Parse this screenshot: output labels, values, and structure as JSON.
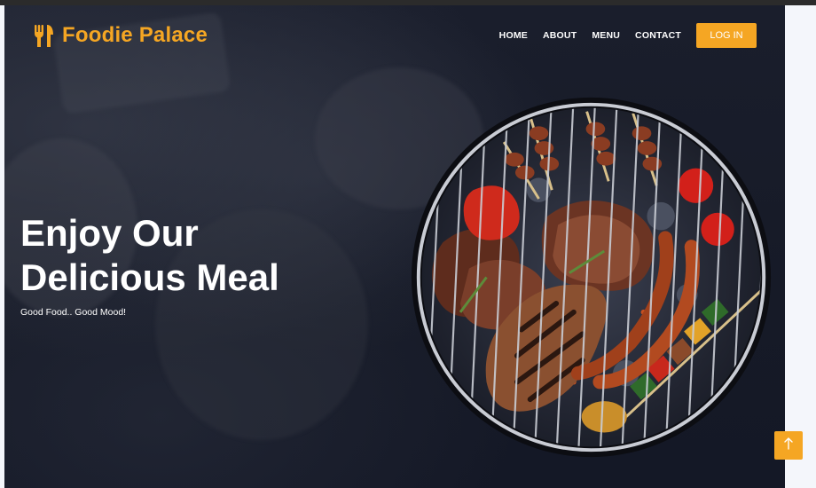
{
  "brand": {
    "name": "Foodie Palace",
    "icon": "utensils-icon",
    "color": "#f5a623"
  },
  "nav": {
    "links": [
      "HOME",
      "ABOUT",
      "MENU",
      "CONTACT"
    ],
    "login_label": "LOG IN"
  },
  "hero": {
    "title": "Enjoy Our Delicious Meal",
    "subtitle": "Good Food.. Good Mood!",
    "image": "grilled-meat-bbq-image"
  },
  "back_to_top": {
    "icon": "arrow-up-icon"
  },
  "colors": {
    "accent": "#f5a623",
    "hero_bg": "#161a27",
    "page_bg": "#f4f6fb"
  }
}
